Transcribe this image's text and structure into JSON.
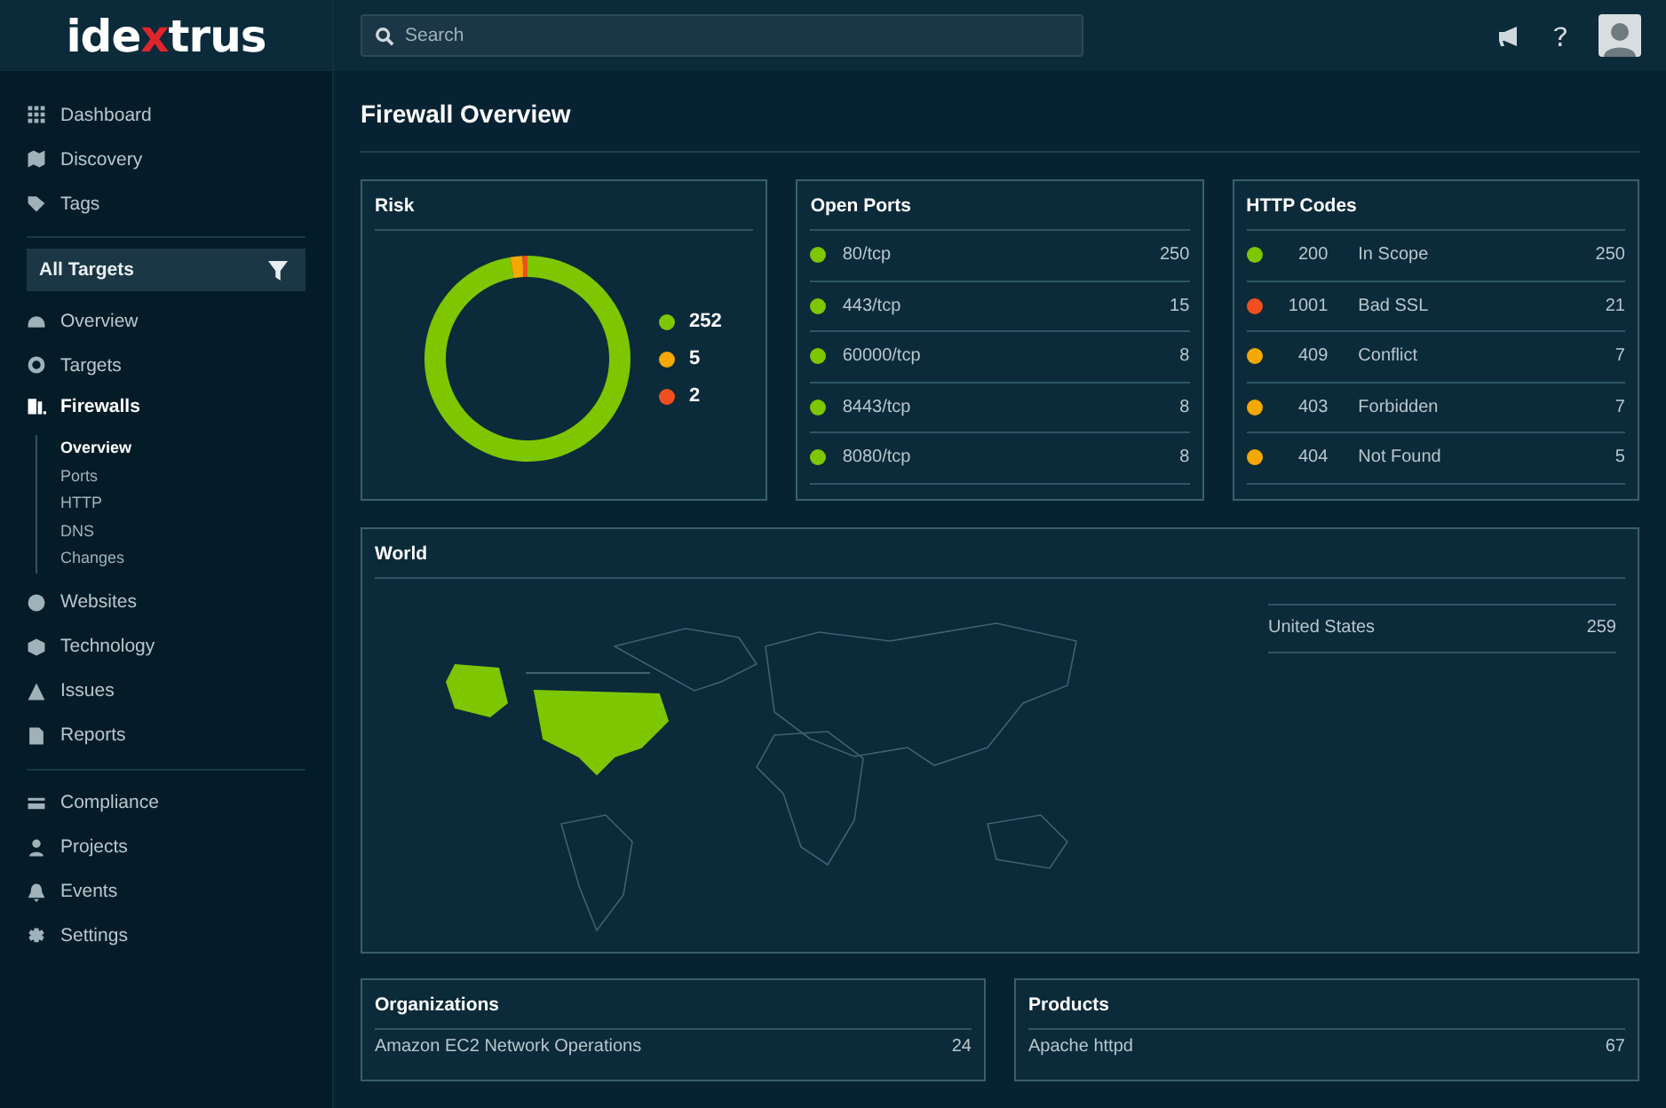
{
  "logo": [
    "ide",
    "x",
    "trus"
  ],
  "search": {
    "placeholder": "Search"
  },
  "sidebar": {
    "sections": [
      {
        "items": [
          {
            "label": "Dashboard",
            "selected": false
          },
          {
            "label": "Discovery",
            "selected": false
          },
          {
            "label": "Tags",
            "selected": false
          }
        ]
      },
      {
        "filter": "All Targets",
        "items": [
          {
            "label": "Overview",
            "selected": false
          },
          {
            "label": "Targets",
            "selected": false
          },
          {
            "label": "Firewalls",
            "selected": true,
            "expanded": true,
            "children": [
              {
                "label": "Overview",
                "selected": true
              },
              {
                "label": "Ports",
                "selected": false
              },
              {
                "label": "HTTP",
                "selected": false
              },
              {
                "label": "DNS",
                "selected": false
              },
              {
                "label": "Changes",
                "selected": false
              }
            ]
          },
          {
            "label": "Websites",
            "selected": false
          },
          {
            "label": "Technology",
            "selected": false
          },
          {
            "label": "Issues",
            "selected": false
          },
          {
            "label": "Reports",
            "selected": false
          }
        ]
      },
      {
        "items": [
          {
            "label": "Compliance",
            "selected": false
          },
          {
            "label": "Projects",
            "selected": false
          },
          {
            "label": "Events",
            "selected": false
          },
          {
            "label": "Settings",
            "selected": false
          }
        ]
      }
    ]
  },
  "page_title": "Firewall Overview",
  "risk": {
    "title": "Risk",
    "chart_data": {
      "type": "donut",
      "categories": [
        "252",
        "5",
        "2"
      ],
      "values": [
        252,
        5,
        2
      ],
      "legend": "right"
    },
    "legend": [
      {
        "color": "#7dc600"
      },
      {
        "color": "#f5a800"
      },
      {
        "color": "#f0501e"
      }
    ]
  },
  "open_ports": {
    "title": "Open Ports",
    "rows": [
      {
        "label": "80/tcp",
        "count": "250",
        "color": "#7dc600"
      },
      {
        "label": "443/tcp",
        "count": "15",
        "color": "#7dc600"
      },
      {
        "label": "60000/tcp",
        "count": "8",
        "color": "#7dc600"
      },
      {
        "label": "8443/tcp",
        "count": "8",
        "color": "#7dc600"
      },
      {
        "label": "8080/tcp",
        "count": "8",
        "color": "#7dc600"
      }
    ]
  },
  "http_codes": {
    "title": "HTTP Codes",
    "rows": [
      {
        "code": "200",
        "label": "In Scope",
        "count": "250",
        "color": "#7dc600"
      },
      {
        "code": "1001",
        "label": "Bad SSL",
        "count": "21",
        "color": "#f0501e"
      },
      {
        "code": "409",
        "label": "Conflict",
        "count": "7",
        "color": "#f5a800"
      },
      {
        "code": "403",
        "label": "Forbidden",
        "count": "7",
        "color": "#f5a800"
      },
      {
        "code": "404",
        "label": "Not Found",
        "count": "5",
        "color": "#f5a800"
      }
    ]
  },
  "world": {
    "title": "World",
    "countries": [
      {
        "name": "United States",
        "count": "259"
      }
    ]
  },
  "organizations": {
    "title": "Organizations",
    "rows": [
      {
        "name": "Amazon EC2 Network Operations",
        "count": "24"
      }
    ]
  },
  "products": {
    "title": "Products",
    "rows": [
      {
        "name": "Apache httpd",
        "count": "67"
      }
    ]
  }
}
